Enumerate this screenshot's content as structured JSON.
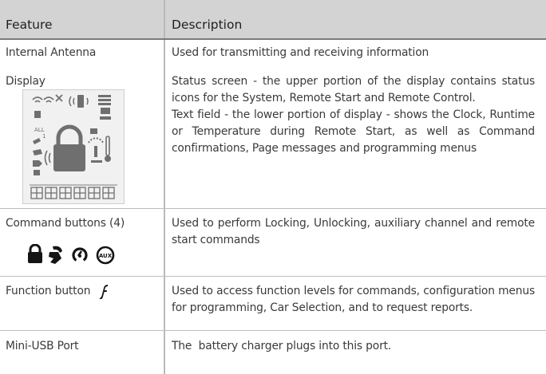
{
  "header": {
    "feature": "Feature",
    "description": "Description"
  },
  "rows": [
    {
      "feature": "Internal Antenna",
      "description": "Used for transmitting and receiving information"
    },
    {
      "feature": "Display",
      "description_1": "Status screen - the upper portion of the display contains status icons for the System, Remote Start and Remote Control.",
      "description_2": "Text field - the lower portion of display - shows the Clock, Runtime or Temperature during Remote Start, as well as Command confirmations, Page messages and programming menus",
      "lcd_labels": {
        "all": "ALL",
        "one": "1"
      }
    },
    {
      "feature": "Command buttons (4)",
      "description": "Used to perform Locking, Unlocking, auxiliary channel and remote start commands",
      "icons": [
        "lock-icon",
        "unlock-icon",
        "remote-start-icon",
        "aux-icon"
      ],
      "aux_label": "AUX"
    },
    {
      "feature": "Function button",
      "description": "Used to access function levels for commands, configuration menus for programming, Car Selection, and to request reports.",
      "icon": "function-f-icon"
    },
    {
      "feature": "Mini-USB Port",
      "description": "The  battery charger plugs into this port."
    }
  ]
}
